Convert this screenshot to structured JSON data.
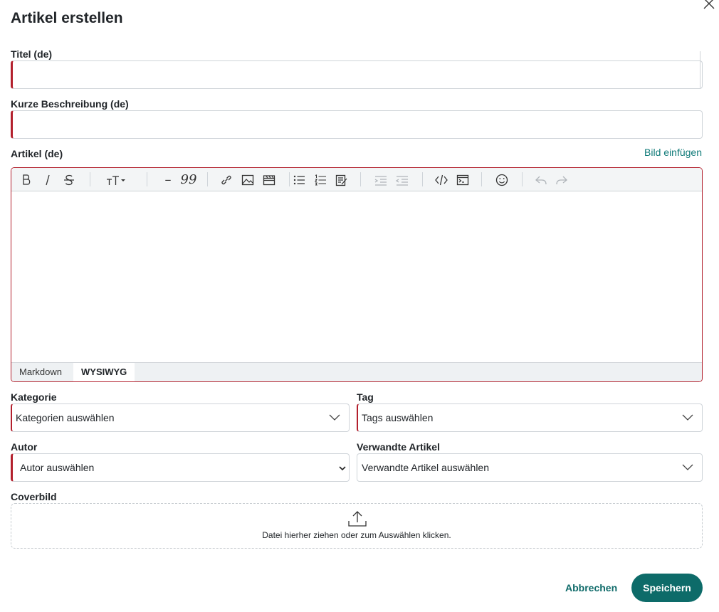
{
  "dialog": {
    "title": "Artikel erstellen"
  },
  "fields": {
    "title_label": "Titel (de)",
    "title_value": "",
    "short_desc_label": "Kurze Beschreibung (de)",
    "short_desc_value": "",
    "article_label": "Artikel (de)",
    "insert_image_link": "Bild einfügen"
  },
  "editor": {
    "toolbar_icons": [
      "bold-icon",
      "italic-icon",
      "strikethrough-icon",
      "heading-icon",
      "horizontal-rule-icon",
      "quote-icon",
      "link-icon",
      "image-icon",
      "video-icon",
      "bullet-list-icon",
      "ordered-list-icon",
      "task-list-icon",
      "indent-icon",
      "outdent-icon",
      "code-icon",
      "code-block-icon",
      "emoji-icon",
      "undo-icon",
      "redo-icon"
    ],
    "hr_glyph": "–",
    "quote_glyph": "99",
    "heading_glyph": "TT",
    "modes": [
      "Markdown",
      "WYSIWYG"
    ],
    "active_mode": "WYSIWYG"
  },
  "selects": {
    "category_label": "Kategorie",
    "category_value": "Kategorien auswählen",
    "tag_label": "Tag",
    "tag_value": "Tags auswählen",
    "author_label": "Autor",
    "author_value": "Autor auswählen",
    "related_label": "Verwandte Artikel",
    "related_value": "Verwandte Artikel auswählen"
  },
  "cover": {
    "label": "Coverbild",
    "dropzone_text": "Datei hierher ziehen oder zum Auswählen klicken."
  },
  "actions": {
    "cancel_label": "Abbrechen",
    "save_label": "Speichern"
  },
  "colors": {
    "accent": "#0d6b69",
    "required": "#b3202d",
    "link": "#0f7a78"
  }
}
